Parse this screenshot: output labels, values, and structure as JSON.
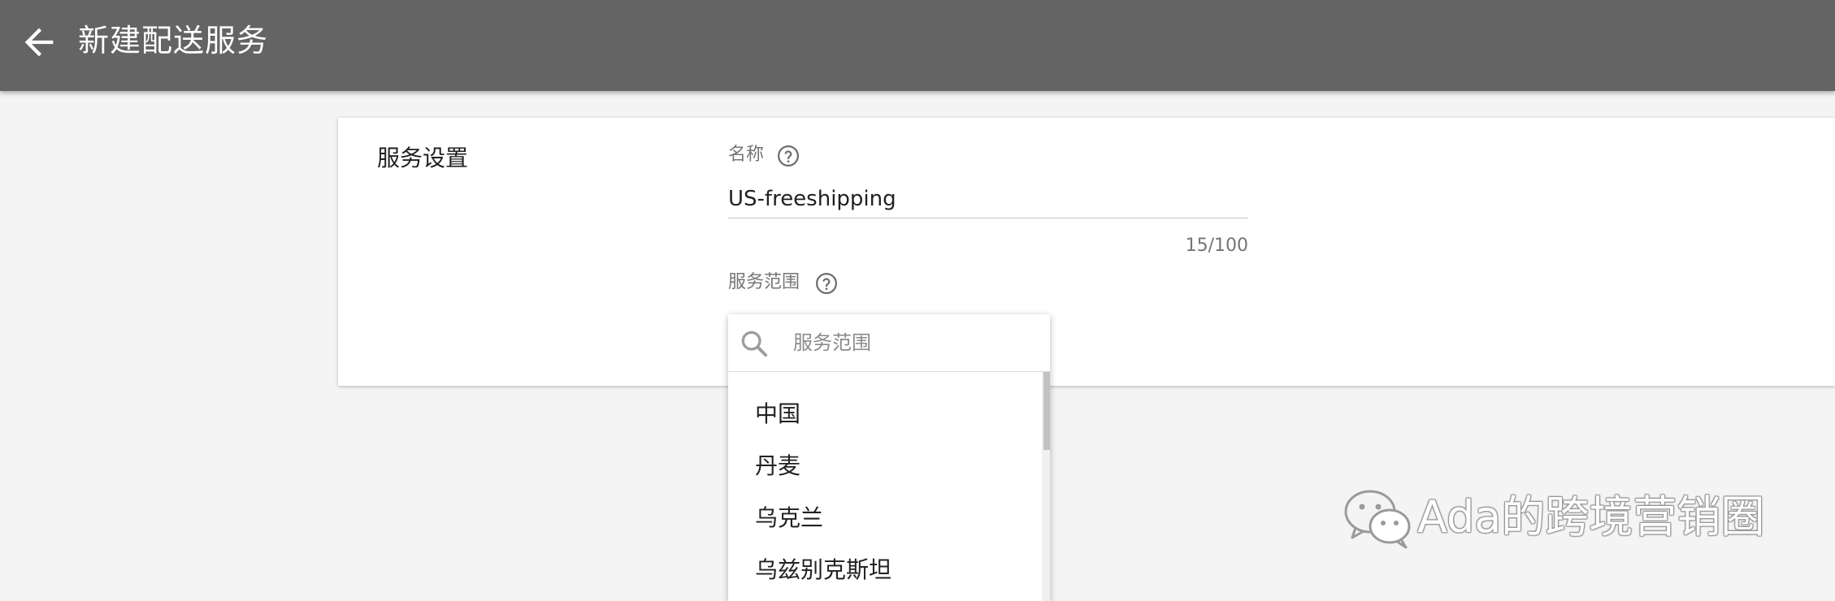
{
  "header": {
    "title": "新建配送服务",
    "back_icon": "arrow-left-icon"
  },
  "service_settings": {
    "section_title": "服务设置",
    "name_field": {
      "label": "名称",
      "value": "US-freeshipping",
      "counter": "15/100"
    },
    "scope_field": {
      "label": "服务范围"
    }
  },
  "scope_dropdown": {
    "search_placeholder": "服务范围",
    "options": [
      {
        "label": "中国"
      },
      {
        "label": "丹麦"
      },
      {
        "label": "乌克兰"
      },
      {
        "label": "乌兹别克斯坦"
      }
    ]
  },
  "watermark": {
    "text": "Ada的跨境营销圈"
  },
  "colors": {
    "topbar": "#646464",
    "page_background": "#f4f4f4",
    "card": "#ffffff"
  }
}
